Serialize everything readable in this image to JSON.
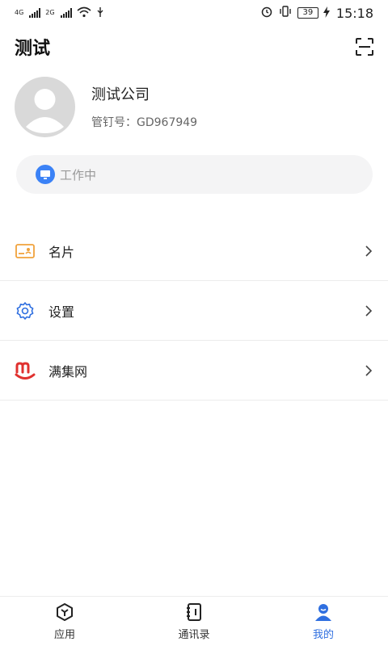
{
  "status_bar": {
    "net1": "4G",
    "net2": "2G",
    "battery": "39",
    "time": "15:18"
  },
  "header": {
    "title": "测试"
  },
  "profile": {
    "company_name": "测试公司",
    "staff_id": "管钉号：GD967949"
  },
  "status_pill": {
    "text": "工作中"
  },
  "menu": {
    "items": [
      {
        "label": "名片"
      },
      {
        "label": "设置"
      },
      {
        "label": "满集网"
      }
    ]
  },
  "bottom_nav": {
    "items": [
      {
        "label": "应用"
      },
      {
        "label": "通讯录"
      },
      {
        "label": "我的"
      }
    ]
  },
  "colors": {
    "accent": "#2f6fe0",
    "card_icon": "#f0a23c",
    "settings_icon": "#2f6fe0",
    "brand_red": "#e0312f"
  }
}
